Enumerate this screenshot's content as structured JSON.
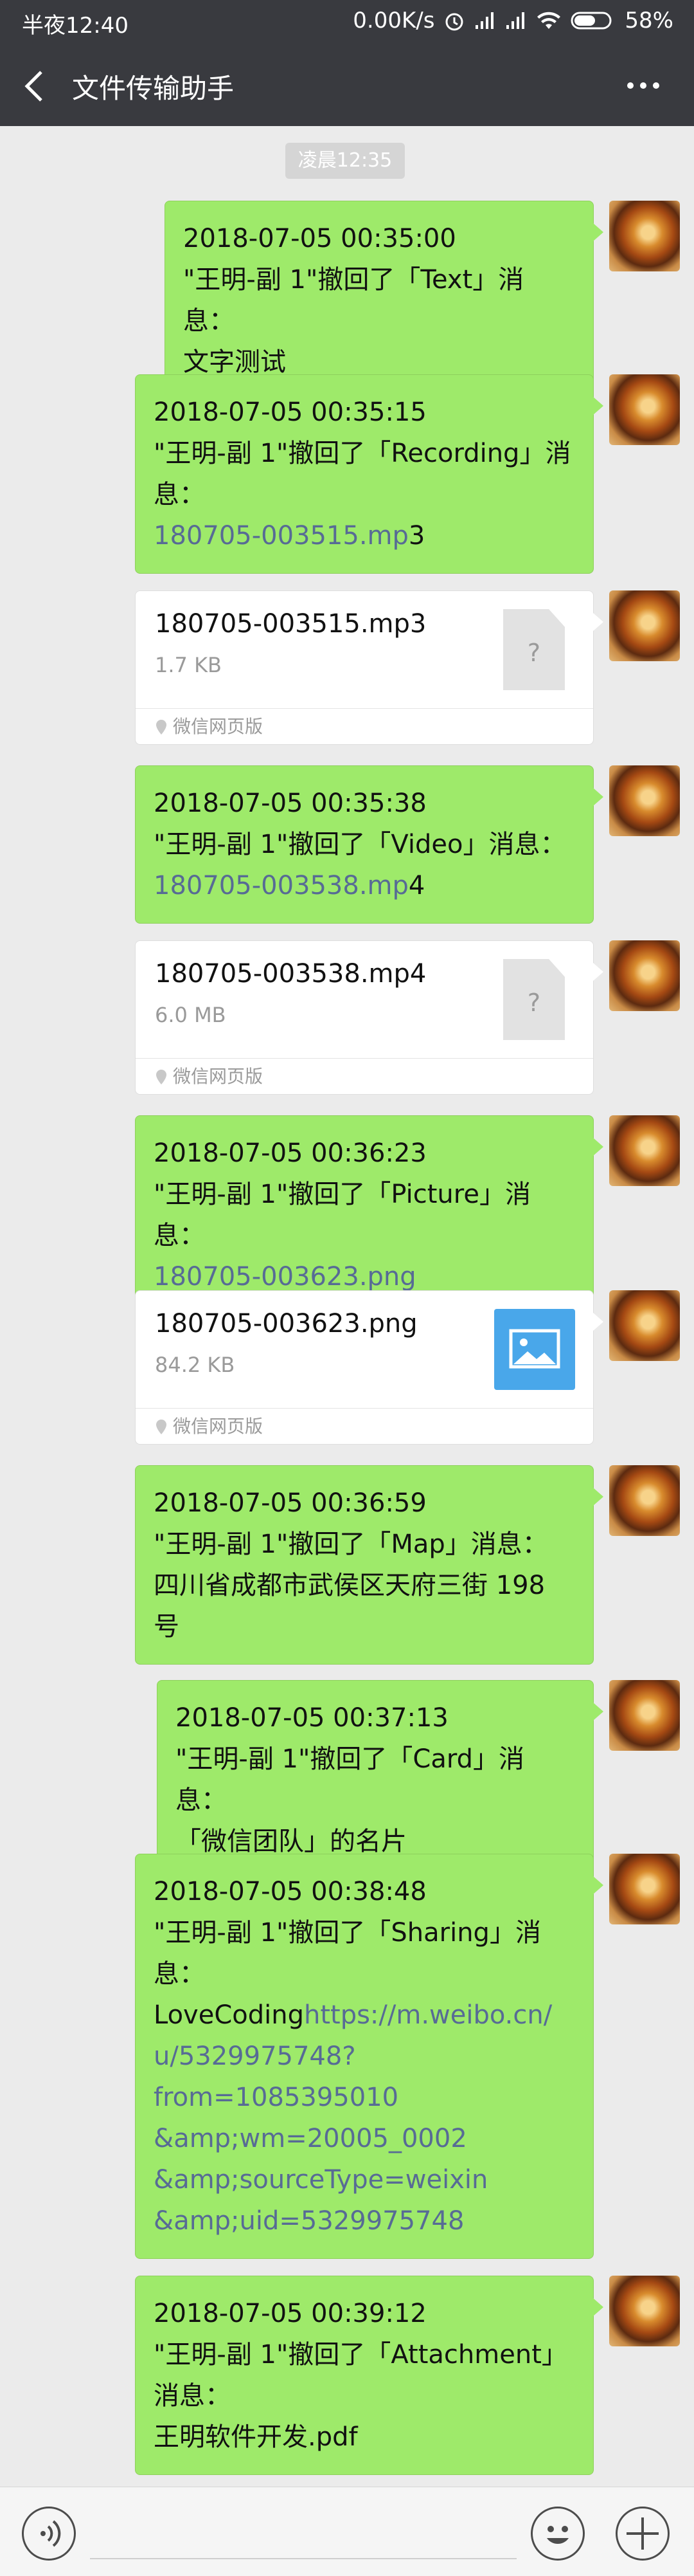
{
  "status_bar": {
    "time": "半夜12:40",
    "speed": "0.00K/s",
    "battery": "58%"
  },
  "header": {
    "title": "文件传输助手"
  },
  "timestamp": "凌晨12:35",
  "messages": {
    "m1": {
      "l1": "2018-07-05 00:35:00",
      "l2": "\"王明-副 1\"撤回了「Text」消息：",
      "l3": "文字测试"
    },
    "m2": {
      "l1": "2018-07-05 00:35:15",
      "l2": "\"王明-副 1\"撤回了「Recording」消",
      "l3": "息：",
      "link": "180705-003515.mp",
      "tail": "3"
    },
    "m3": {
      "l1": "2018-07-05 00:35:38",
      "l2": "\"王明-副 1\"撤回了「Video」消息：",
      "link": "180705-003538.mp",
      "tail": "4"
    },
    "m4": {
      "l1": "2018-07-05 00:36:23",
      "l2": "\"王明-副 1\"撤回了「Picture」消息：",
      "link": "180705-003623.png"
    },
    "m5": {
      "l1": "2018-07-05 00:36:59",
      "l2": "\"王明-副 1\"撤回了「Map」消息：",
      "l3": "四川省成都市武侯区天府三街 198",
      "l4": "号"
    },
    "m6": {
      "l1": "2018-07-05 00:37:13",
      "l2": "\"王明-副 1\"撤回了「Card」消息：",
      "l3": "「微信团队」的名片"
    },
    "m7": {
      "l1": "2018-07-05 00:38:48",
      "l2": "\"王明-副 1\"撤回了「Sharing」消",
      "l3": "息：",
      "text": "LoveCoding",
      "link1": "https://m.weibo.cn/",
      "link2": "u/5329975748?",
      "link3": "from=1085395010",
      "link4": "&amp;wm=20005_0002",
      "link5": "&amp;sourceType=weixin",
      "link6": "&amp;uid=5329975748"
    },
    "m8": {
      "l1": "2018-07-05 00:39:12",
      "l2": "\"王明-副 1\"撤回了「Attachment」",
      "l3": "消息：",
      "l4": "王明软件开发.pdf"
    }
  },
  "files": {
    "f1": {
      "name": "180705-003515.mp3",
      "size": "1.7 KB",
      "source": "微信网页版",
      "icon": "unknown-file-icon"
    },
    "f2": {
      "name": "180705-003538.mp4",
      "size": "6.0 MB",
      "source": "微信网页版",
      "icon": "unknown-file-icon"
    },
    "f3": {
      "name": "180705-003623.png",
      "size": "84.2 KB",
      "source": "微信网页版",
      "icon": "image-icon"
    }
  },
  "colors": {
    "bubble": "#9eea6a",
    "link": "#576b95",
    "header": "#393a3f",
    "background": "#ebebeb"
  }
}
